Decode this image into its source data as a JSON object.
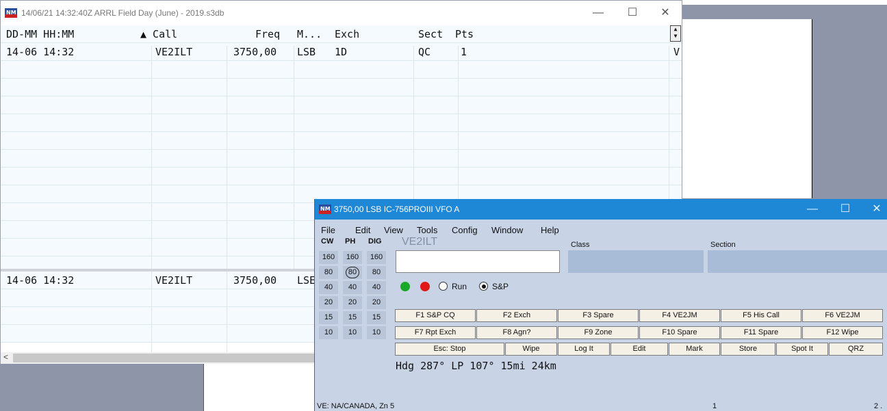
{
  "log_window": {
    "title": "14/06/21 14:32:40Z  ARRL Field Day (June) - 2019.s3db",
    "controls": {
      "minimize": "—",
      "maximize": "☐",
      "close": "✕"
    },
    "columns": [
      "DD-MM HH:MM",
      "▲ Call",
      "Freq",
      "M...",
      "Exch",
      "Sect",
      "Pts"
    ],
    "rows": [
      {
        "date_time": "14-06 14:32",
        "call": "VE2ILT",
        "freq": "3750,00",
        "mode": "LSB",
        "exch": "1D",
        "sect": "QC",
        "pts": "1",
        "extra": "V"
      }
    ],
    "lower_row": {
      "date_time": "14-06 14:32",
      "call": "VE2ILT",
      "freq": "3750,00",
      "mode": "LSE"
    },
    "hscroll_arrow": "<"
  },
  "entry_window": {
    "title": "3750,00 LSB IC-756PROIII VFO A",
    "controls": {
      "minimize": "—",
      "maximize": "☐",
      "close": "✕"
    },
    "menu": [
      "File",
      "Edit",
      "View",
      "Tools",
      "Config",
      "Window",
      "Help"
    ],
    "band_headers": [
      "CW",
      "PH",
      "DIG"
    ],
    "bands": {
      "cw": [
        "160",
        "80",
        "40",
        "20",
        "15",
        "10"
      ],
      "ph": [
        "160",
        "80",
        "40",
        "20",
        "15",
        "10"
      ],
      "dig": [
        "160",
        "80",
        "40",
        "20",
        "15",
        "10"
      ],
      "selected_ph": "80"
    },
    "callsign_label": "VE2ILT",
    "call_input_value": "",
    "class_label": "Class",
    "section_label": "Section",
    "led_colors": {
      "green": "#1aa82a",
      "red": "#e01818"
    },
    "radio_run": "Run",
    "radio_sp": "S&P",
    "selected_radio": "S&P",
    "fkeys_row1": [
      "F1 S&P CQ",
      "F2 Exch",
      "F3 Spare",
      "F4 VE2JM",
      "F5 His Call",
      "F6 VE2JM"
    ],
    "fkeys_row2": [
      "F7 Rpt Exch",
      "F8 Agn?",
      "F9 Zone",
      "F10 Spare",
      "F11 Spare",
      "F12 Wipe"
    ],
    "fkeys_row3": [
      "Esc: Stop",
      "Wipe",
      "Log It",
      "Edit",
      "Mark",
      "Store",
      "Spot It",
      "QRZ"
    ],
    "heading": "Hdg 287° LP 107° 15mi 24km",
    "status_left": "VE: NA/CANADA, Zn 5",
    "status_mid": "1",
    "status_right": "2 ."
  },
  "colors": {
    "title_bar": "#1e88d6",
    "panel": "#c8d4e6",
    "field": "#a8bcd8",
    "grid_row": "#f4fafd",
    "desktop": "#8e95a8"
  }
}
